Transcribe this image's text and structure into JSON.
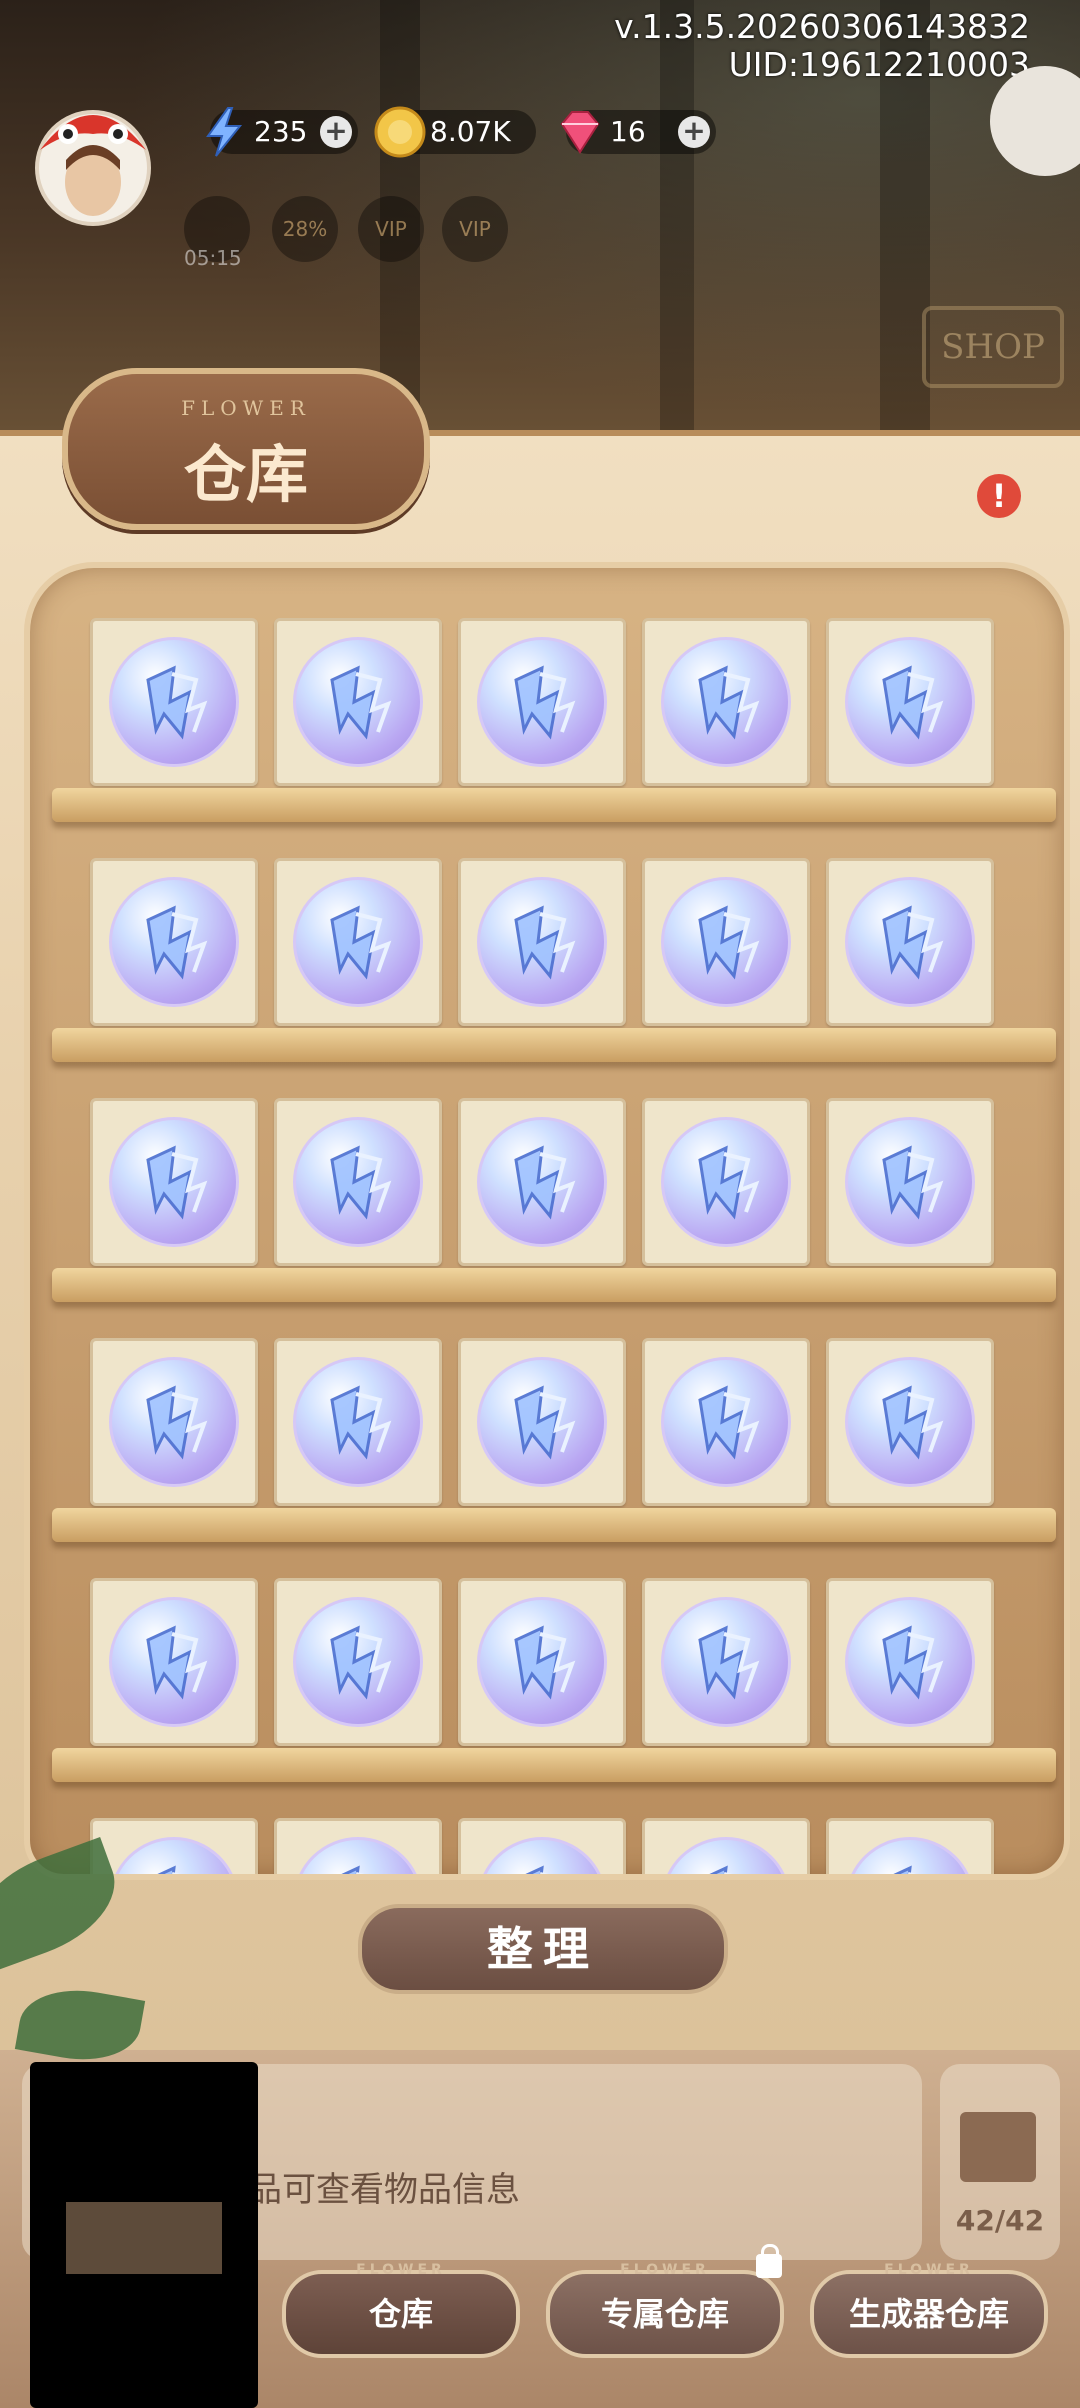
{
  "header": {
    "version": "v.1.3.5.20260306143832",
    "uid": "UID:19612210003"
  },
  "resources": {
    "energy": {
      "value": "235",
      "icon": "lightning-icon"
    },
    "coins": {
      "value": "8.07K",
      "icon": "coin-icon"
    },
    "gems": {
      "value": "16",
      "icon": "gem-icon"
    },
    "plus": "+"
  },
  "buffs": {
    "timer": "05:15",
    "percent": "28%",
    "vip1": "VIP",
    "vip2": "VIP"
  },
  "shop_sign": "SHOP",
  "panel": {
    "title_small": "FLOWER",
    "title": "仓库",
    "alert": "!",
    "item_icon": "crystal-orb-icon"
  },
  "sort_button": "整理",
  "info": {
    "hint": "品可查看物品信息",
    "capacity": "42/42"
  },
  "tabs": [
    {
      "label": "仓库",
      "flower": "FLOWER",
      "active": true
    },
    {
      "label": "专属仓库",
      "flower": "FLOWER",
      "locked": true
    },
    {
      "label": "生成器仓库",
      "flower": "FLOWER"
    }
  ],
  "colors": {
    "accent": "#7a4f34",
    "panel": "#f1dfc1",
    "alert": "#e04a3a"
  }
}
